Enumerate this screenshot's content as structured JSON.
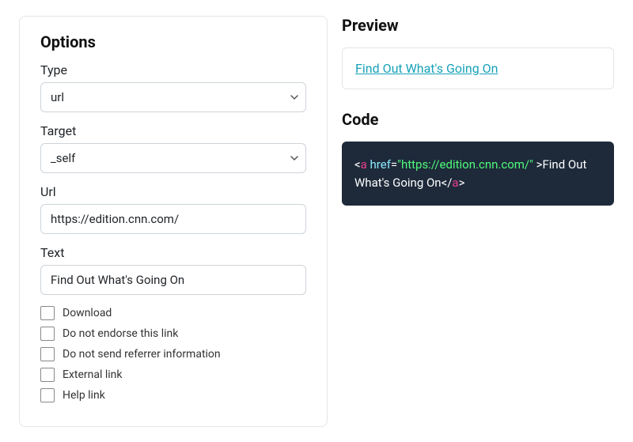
{
  "options": {
    "title": "Options",
    "fields": {
      "type": {
        "label": "Type",
        "value": "url"
      },
      "target": {
        "label": "Target",
        "value": "_self"
      },
      "url": {
        "label": "Url",
        "value": "https://edition.cnn.com/"
      },
      "text": {
        "label": "Text",
        "value": "Find Out What's Going On"
      }
    },
    "checks": [
      {
        "label": "Download"
      },
      {
        "label": "Do not endorse this link"
      },
      {
        "label": "Do not send referrer information"
      },
      {
        "label": "External link"
      },
      {
        "label": "Help link"
      }
    ]
  },
  "preview": {
    "title": "Preview",
    "link_text": "Find Out What's Going On"
  },
  "code": {
    "title": "Code",
    "bracket_open": "<",
    "tag": "a",
    "space": " ",
    "attr": "href",
    "eq": "=",
    "str": "\"https://edition.cnn.com/\"",
    "close_space": " >",
    "inner": "Find Out What's Going On",
    "bracket_open2": "</",
    "tag2": "a",
    "bracket_close2": ">"
  }
}
